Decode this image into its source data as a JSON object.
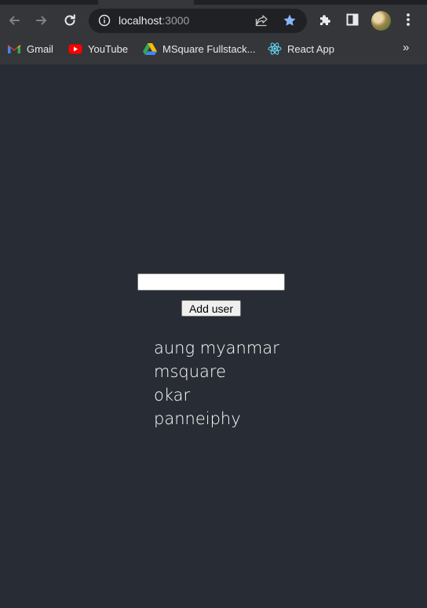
{
  "browser": {
    "url_host": "localhost",
    "url_port": ":3000",
    "icons": {
      "back": "back-arrow-icon",
      "forward": "forward-arrow-icon",
      "reload": "reload-icon",
      "info": "info-icon",
      "share": "share-icon",
      "star": "star-icon",
      "extensions": "puzzle-icon",
      "side_panel": "side-panel-icon",
      "menu": "kebab-menu-icon"
    },
    "accent_color": "#8ab4f8"
  },
  "bookmarks": [
    {
      "label": "Gmail",
      "icon": "gmail-icon"
    },
    {
      "label": "YouTube",
      "icon": "youtube-icon"
    },
    {
      "label": "MSquare Fullstack...",
      "icon": "google-drive-icon"
    },
    {
      "label": "React App",
      "icon": "react-icon"
    }
  ],
  "bookmarks_overflow": "»",
  "app": {
    "background_color": "#282c34",
    "input_value": "",
    "add_button_label": "Add user",
    "users": [
      "aung myanmar",
      "msquare",
      "okar",
      "panneiphy"
    ]
  }
}
